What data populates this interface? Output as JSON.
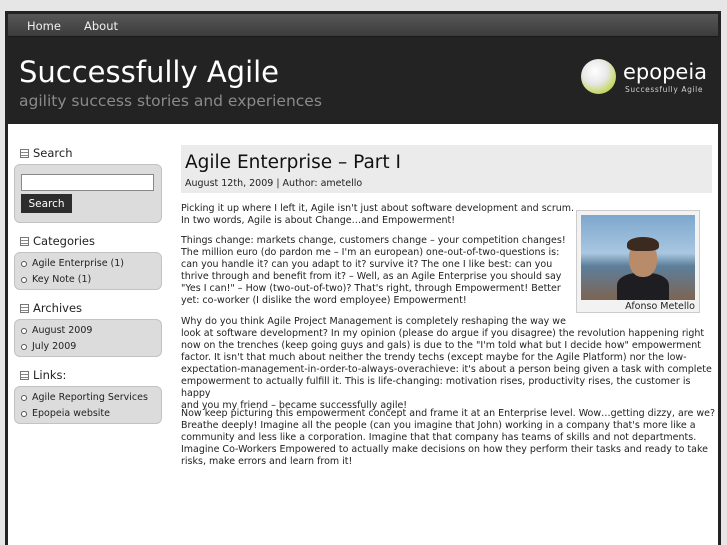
{
  "nav": {
    "items": [
      "Home",
      "About"
    ]
  },
  "header": {
    "title": "Successfully Agile",
    "tagline": "agility success stories and experiences",
    "logo_name": "epopeia",
    "logo_sub": "Successfully Agile"
  },
  "sidebar": {
    "search": {
      "title": "Search",
      "button": "Search",
      "value": ""
    },
    "categories": {
      "title": "Categories",
      "items": [
        "Agile Enterprise (1)",
        "Key Note (1)"
      ]
    },
    "archives": {
      "title": "Archives",
      "items": [
        "August 2009",
        "July 2009"
      ]
    },
    "links": {
      "title": "Links:",
      "items": [
        "Agile Reporting Services",
        "Epopeia website"
      ]
    }
  },
  "post": {
    "title": "Agile Enterprise – Part I",
    "meta": "August 12th, 2009 | Author: ametello",
    "photo_caption": "Afonso Metello",
    "paragraphs": [
      [
        "Picking it up where I left it, Agile isn't just about software development and scrum.",
        "In two words, Agile is about Change…and Empowerment!"
      ],
      [
        "Things change:  markets change, customers change – your competition changes!",
        "The million euro (do pardon me – I'm an european) one-out-of-two-questions is:",
        "can you handle it? can you adapt to it? survive it? The one I like best: can you",
        "thrive through and benefit from it? – Well, as an Agile Enterprise you should say",
        "\"Yes I can!\" – How (two-out-of-two)?  That's right, through Empowerment!  Better",
        "yet: co-worker (I dislike the word employee) Empowerment!"
      ],
      [
        "Why do you think Agile Project Management is completely reshaping the way we",
        "look at software development?  In my opinion (please do argue if you disagree) the revolution happening right",
        "now on the trenches (keep going guys and gals) is due to the \"I'm told what but I decide how\" empowerment",
        "factor. It isn't that much about neither the trendy techs (except maybe for the Agile Platform) nor the low-",
        "expectation-management-in-order-to-always-overachieve: it's about a person being given a task with complete",
        "empowerment to actually fulfill it. This is life-changing: motivation rises, productivity rises, the customer is happy",
        "and you my friend – became successfully agile!"
      ],
      [
        "Now keep picturing this empowerment concept and frame it at an Enterprise level. Wow…getting dizzy, are we?",
        "Breathe deeply! Imagine all the people (can you imagine that John) working in a company that's more like a",
        "community and less like a corporation. Imagine that that company has teams of skills and not departments.",
        "Imagine Co-Workers Empowered to actually make decisions on how they perform their tasks and ready to take",
        "risks, make errors and learn from it!"
      ]
    ]
  }
}
